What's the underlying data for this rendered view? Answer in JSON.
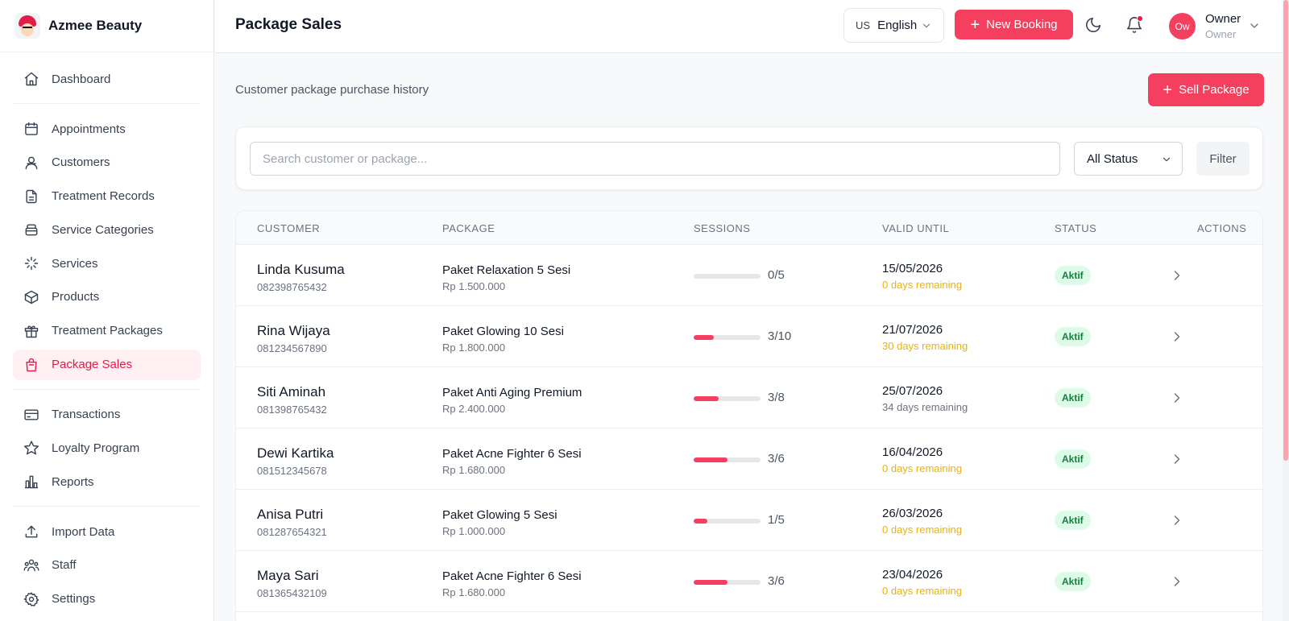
{
  "brand": {
    "name": "Azmee Beauty"
  },
  "sidebar": {
    "groups": [
      [
        {
          "label": "Dashboard",
          "icon": "home-icon"
        }
      ],
      [
        {
          "label": "Appointments",
          "icon": "calendar-icon"
        },
        {
          "label": "Customers",
          "icon": "users-icon"
        },
        {
          "label": "Treatment Records",
          "icon": "file-icon"
        },
        {
          "label": "Service Categories",
          "icon": "layers-icon"
        },
        {
          "label": "Services",
          "icon": "sparkles-icon"
        },
        {
          "label": "Products",
          "icon": "box-icon"
        },
        {
          "label": "Treatment Packages",
          "icon": "gift-icon"
        },
        {
          "label": "Package Sales",
          "icon": "shopping-bag-icon",
          "active": true
        }
      ],
      [
        {
          "label": "Transactions",
          "icon": "credit-card-icon"
        },
        {
          "label": "Loyalty Program",
          "icon": "star-icon"
        },
        {
          "label": "Reports",
          "icon": "bar-chart-icon"
        }
      ],
      [
        {
          "label": "Import Data",
          "icon": "upload-icon"
        },
        {
          "label": "Staff",
          "icon": "team-icon"
        },
        {
          "label": "Settings",
          "icon": "gear-icon"
        }
      ]
    ]
  },
  "header": {
    "title": "Package Sales",
    "language_code": "US",
    "language": "English",
    "new_booking_label": "New Booking",
    "user_initials": "Ow",
    "user_name": "Owner",
    "user_role": "Owner"
  },
  "main": {
    "subtitle": "Customer package purchase history",
    "sell_package_label": "Sell Package",
    "search_placeholder": "Search customer or package...",
    "status_filter": "All Status",
    "filter_label": "Filter"
  },
  "table": {
    "columns": [
      "CUSTOMER",
      "PACKAGE",
      "SESSIONS",
      "VALID UNTIL",
      "STATUS",
      "ACTIONS"
    ],
    "rows": [
      {
        "customer": "Linda Kusuma",
        "phone": "082398765432",
        "package": "Paket Relaxation 5 Sesi",
        "price": "Rp 1.500.000",
        "used": 0,
        "total": 5,
        "sessions": "0/5",
        "valid_until": "15/05/2026",
        "remaining": "0 days remaining",
        "remaining_warn": true,
        "status": "Aktif"
      },
      {
        "customer": "Rina Wijaya",
        "phone": "081234567890",
        "package": "Paket Glowing 10 Sesi",
        "price": "Rp 1.800.000",
        "used": 3,
        "total": 10,
        "sessions": "3/10",
        "valid_until": "21/07/2026",
        "remaining": "30 days remaining",
        "remaining_warn": true,
        "status": "Aktif"
      },
      {
        "customer": "Siti Aminah",
        "phone": "081398765432",
        "package": "Paket Anti Aging Premium",
        "price": "Rp 2.400.000",
        "used": 3,
        "total": 8,
        "sessions": "3/8",
        "valid_until": "25/07/2026",
        "remaining": "34 days remaining",
        "remaining_warn": false,
        "status": "Aktif"
      },
      {
        "customer": "Dewi Kartika",
        "phone": "081512345678",
        "package": "Paket Acne Fighter 6 Sesi",
        "price": "Rp 1.680.000",
        "used": 3,
        "total": 6,
        "sessions": "3/6",
        "valid_until": "16/04/2026",
        "remaining": "0 days remaining",
        "remaining_warn": true,
        "status": "Aktif"
      },
      {
        "customer": "Anisa Putri",
        "phone": "081287654321",
        "package": "Paket Glowing 5 Sesi",
        "price": "Rp 1.000.000",
        "used": 1,
        "total": 5,
        "sessions": "1/5",
        "valid_until": "26/03/2026",
        "remaining": "0 days remaining",
        "remaining_warn": true,
        "status": "Aktif"
      },
      {
        "customer": "Maya Sari",
        "phone": "081365432109",
        "package": "Paket Acne Fighter 6 Sesi",
        "price": "Rp 1.680.000",
        "used": 3,
        "total": 6,
        "sessions": "3/6",
        "valid_until": "23/04/2026",
        "remaining": "0 days remaining",
        "remaining_warn": true,
        "status": "Aktif"
      }
    ]
  },
  "colors": {
    "accent": "#f43f5e",
    "active_bg": "#fff0f3",
    "badge_bg": "#dcfce7",
    "badge_text": "#15803d",
    "warn": "#eab308"
  }
}
